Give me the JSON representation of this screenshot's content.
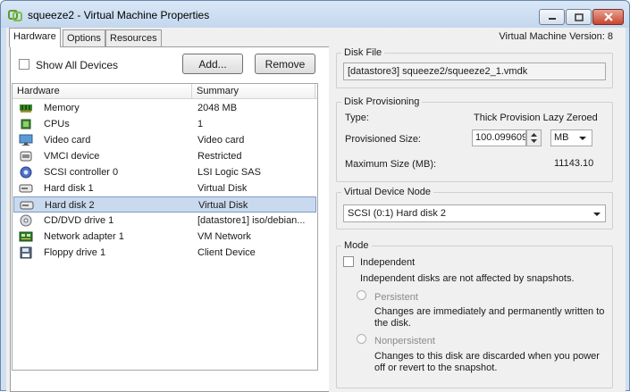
{
  "window": {
    "title": "squeeze2 - Virtual Machine Properties",
    "vm_version": "Virtual Machine Version: 8"
  },
  "tabs": [
    {
      "label": "Hardware"
    },
    {
      "label": "Options"
    },
    {
      "label": "Resources"
    }
  ],
  "toolbar": {
    "show_all_devices": "Show All Devices",
    "add_label": "Add...",
    "remove_label": "Remove"
  },
  "hardware_table": {
    "columns": [
      "Hardware",
      "Summary"
    ],
    "rows": [
      {
        "name": "Memory",
        "summary": "2048 MB",
        "icon": "memory-icon"
      },
      {
        "name": "CPUs",
        "summary": "1",
        "icon": "cpu-icon"
      },
      {
        "name": "Video card",
        "summary": "Video card",
        "icon": "video-card-icon"
      },
      {
        "name": "VMCI device",
        "summary": "Restricted",
        "icon": "vmci-icon"
      },
      {
        "name": "SCSI controller 0",
        "summary": "LSI Logic SAS",
        "icon": "scsi-controller-icon"
      },
      {
        "name": "Hard disk 1",
        "summary": "Virtual Disk",
        "icon": "hard-disk-icon"
      },
      {
        "name": "Hard disk 2",
        "summary": "Virtual Disk",
        "icon": "hard-disk-icon",
        "selected": true
      },
      {
        "name": "CD/DVD drive 1",
        "summary": "[datastore1] iso/debian...",
        "icon": "cd-dvd-icon"
      },
      {
        "name": "Network adapter 1",
        "summary": "VM Network",
        "icon": "network-adapter-icon"
      },
      {
        "name": "Floppy drive 1",
        "summary": "Client Device",
        "icon": "floppy-icon"
      }
    ]
  },
  "disk_file": {
    "label": "Disk File",
    "value": "[datastore3] squeeze2/squeeze2_1.vmdk"
  },
  "disk_provisioning": {
    "label": "Disk Provisioning",
    "type_label": "Type:",
    "type_value": "Thick Provision Lazy Zeroed",
    "size_label": "Provisioned Size:",
    "size_value": "100.099609",
    "unit_value": "MB",
    "max_label": "Maximum Size (MB):",
    "max_value": "11143.10"
  },
  "device_node": {
    "label": "Virtual Device Node",
    "value": "SCSI (0:1) Hard disk 2"
  },
  "mode": {
    "label": "Mode",
    "independent_label": "Independent",
    "independent_desc": "Independent disks are not affected by snapshots.",
    "persistent_label": "Persistent",
    "persistent_desc_1": "Changes are immediately and permanently written to",
    "persistent_desc_2": "the disk.",
    "nonpersistent_label": "Nonpersistent",
    "nonpersistent_desc_1": "Changes to this disk are discarded when you power",
    "nonpersistent_desc_2": "off or revert to the snapshot."
  },
  "colors": {
    "titlebar": "#c3d7ed",
    "selection": "#c9d9ee",
    "close_button": "#c9452f"
  }
}
